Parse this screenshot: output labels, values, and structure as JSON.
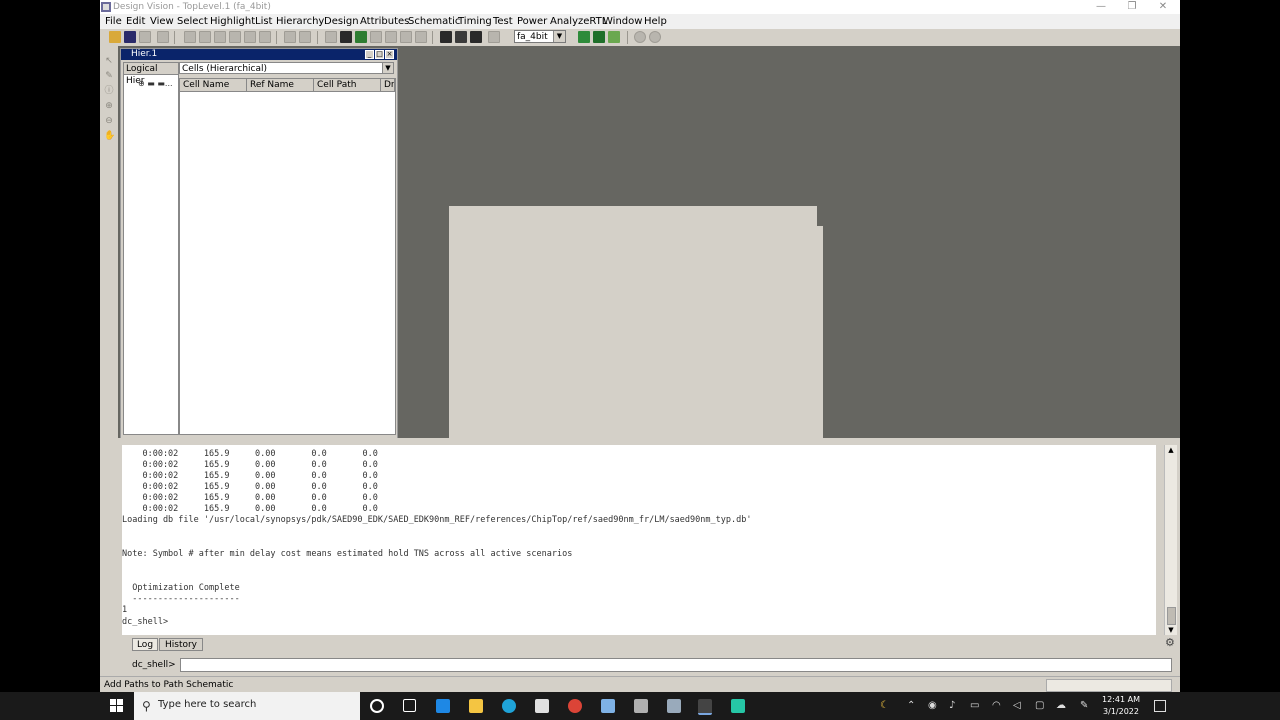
{
  "window": {
    "title": "Design Vision - TopLevel.1 (fa_4bit)",
    "min": "—",
    "max": "❐",
    "close": "✕"
  },
  "menu": [
    "File",
    "Edit",
    "View",
    "Select",
    "Highlight",
    "List",
    "Hierarchy",
    "Design",
    "Attributes",
    "Schematic",
    "Timing",
    "Test",
    "Power",
    "AnalyzeRTL",
    "Window",
    "Help"
  ],
  "toolbar": {
    "design_select": "fa_4bit",
    "arrow": "▼"
  },
  "hier_window": {
    "title": "Hier.1",
    "logical_tab": "Logical Hier",
    "tree_node": "⊕ ▬ ▬...",
    "cells_dropdown": "Cells (Hierarchical)",
    "columns": [
      "Cell Name",
      "Ref Name",
      "Cell Path",
      "Dr"
    ]
  },
  "console": {
    "lines": [
      "    0:00:02     165.9     0.00       0.0       0.0",
      "    0:00:02     165.9     0.00       0.0       0.0",
      "    0:00:02     165.9     0.00       0.0       0.0",
      "    0:00:02     165.9     0.00       0.0       0.0",
      "    0:00:02     165.9     0.00       0.0       0.0",
      "    0:00:02     165.9     0.00       0.0       0.0",
      "Loading db file '/usr/local/synopsys/pdk/SAED90_EDK/SAED_EDK90nm_REF/references/ChipTop/ref/saed90nm_fr/LM/saed90nm_typ.db'",
      "",
      "",
      "Note: Symbol # after min delay cost means estimated hold TNS across all active scenarios",
      "",
      "",
      "  Optimization Complete",
      "  ---------------------",
      "1",
      "dc_shell>"
    ],
    "tabs": [
      "Log",
      "History"
    ],
    "prompt_label": "dc_shell>",
    "prompt_value": ""
  },
  "status_text": "Add Paths to Path Schematic",
  "taskbar": {
    "search_placeholder": "Type here to search",
    "time": "12:41 AM",
    "date": "3/1/2022"
  },
  "colors": {
    "titlebar_active": "#0a246a",
    "workspace": "#666661",
    "taskbar": "#1a1a1a"
  }
}
